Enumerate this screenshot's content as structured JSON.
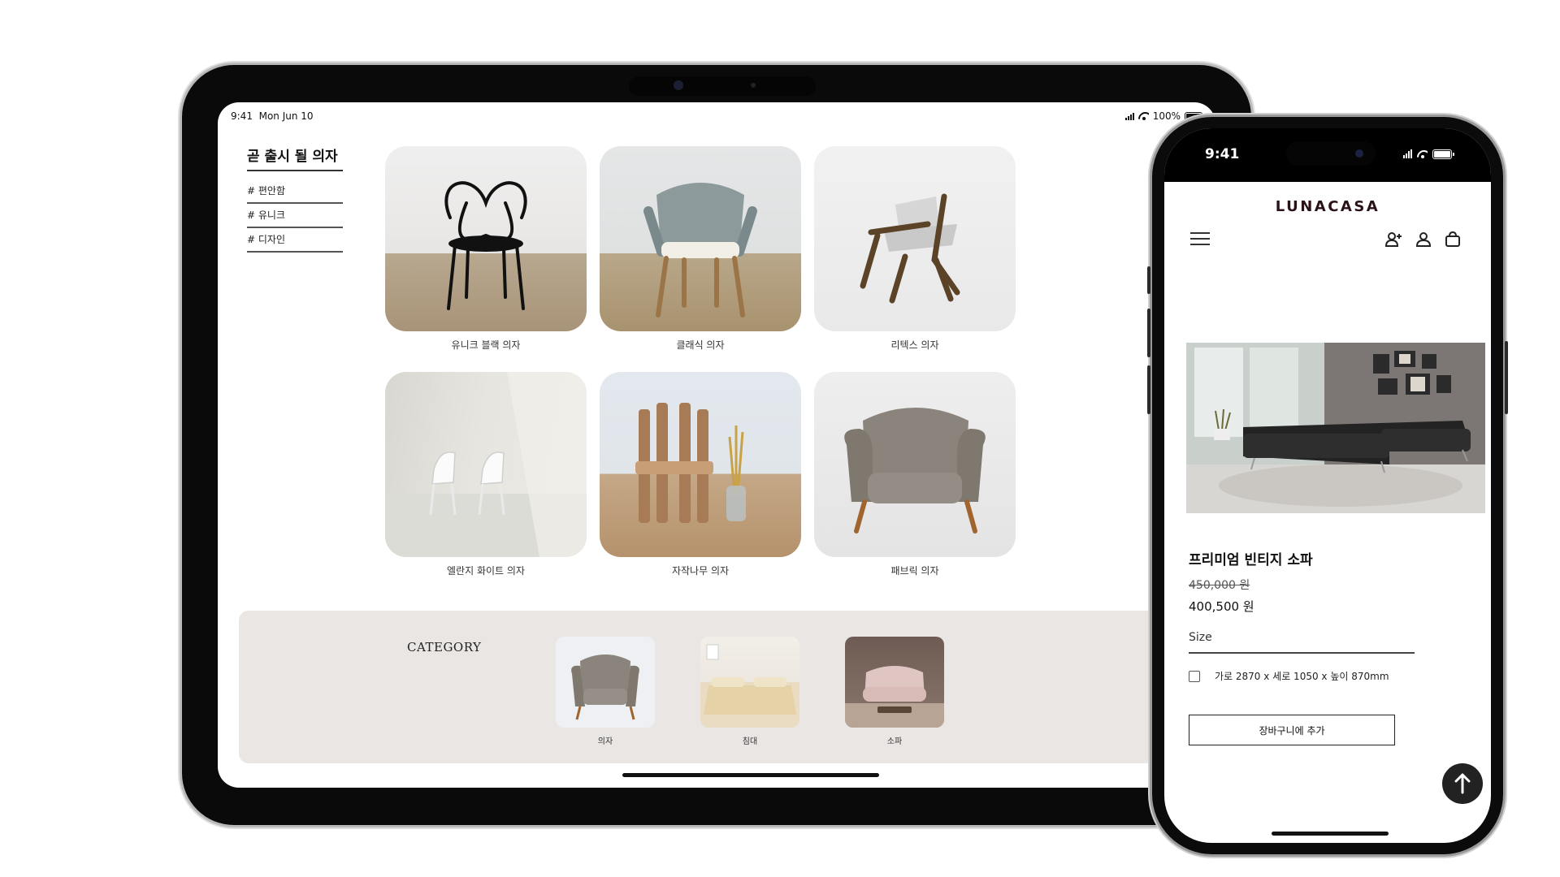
{
  "ipad": {
    "status": {
      "time": "9:41",
      "date": "Mon Jun 10",
      "battery": "100%"
    },
    "sidebar": {
      "title": "곧 출시 될 의자",
      "tags": [
        "# 편안함",
        "# 유니크",
        "# 디자인"
      ]
    },
    "products": [
      {
        "name": "유니크 블랙 의자",
        "icon": "black-loop-chair"
      },
      {
        "name": "클래식 의자",
        "icon": "rope-armchair"
      },
      {
        "name": "리텍스 의자",
        "icon": "wood-lounge-chair"
      },
      {
        "name": "엘란지 화이트 의자",
        "icon": "white-chairs"
      },
      {
        "name": "자작나무 의자",
        "icon": "birch-chair"
      },
      {
        "name": "패브릭 의자",
        "icon": "fabric-armchair"
      }
    ],
    "category": {
      "title": "CATEGORY",
      "items": [
        {
          "label": "의자",
          "icon": "armchair"
        },
        {
          "label": "침대",
          "icon": "bed"
        },
        {
          "label": "소파",
          "icon": "sofa"
        }
      ]
    }
  },
  "iphone": {
    "status": {
      "time": "9:41"
    },
    "brand": "LUNACASA",
    "header_icons": [
      "menu-icon",
      "add-user-icon",
      "user-icon",
      "bag-icon"
    ],
    "product": {
      "title": "프리미엄 빈티지 소파",
      "old_price": "450,000 원",
      "price": "400,500 원",
      "size_label": "Size",
      "size_option": "가로 2870 x 세로 1050 x 높이 870mm",
      "size_option_checked": false,
      "cart_button": "장바구니에 추가"
    }
  },
  "colors": {
    "brand": "#2a1216",
    "category_band": "#e9e6e4",
    "device_frame": "#0a0a0a"
  }
}
